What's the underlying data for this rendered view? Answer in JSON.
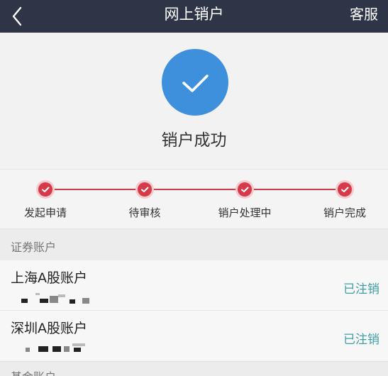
{
  "navbar": {
    "back_icon": "chevron-left-icon",
    "title": "网上销户",
    "service_label": "客服"
  },
  "result": {
    "icon": "checkmark-icon",
    "message": "销户成功",
    "accent_color": "#3e8fdc"
  },
  "progress": {
    "accent_color": "#d43a49",
    "steps": [
      {
        "label": "发起申请",
        "done": true
      },
      {
        "label": "待审核",
        "done": true
      },
      {
        "label": "销户处理中",
        "done": true
      },
      {
        "label": "销户完成",
        "done": true
      }
    ]
  },
  "securities_section": {
    "title": "证券账户",
    "accounts": [
      {
        "name": "上海A股账户",
        "status": "已注销"
      },
      {
        "name": "深圳A股账户",
        "status": "已注销"
      }
    ]
  },
  "fund_section": {
    "title": "基金账户"
  }
}
